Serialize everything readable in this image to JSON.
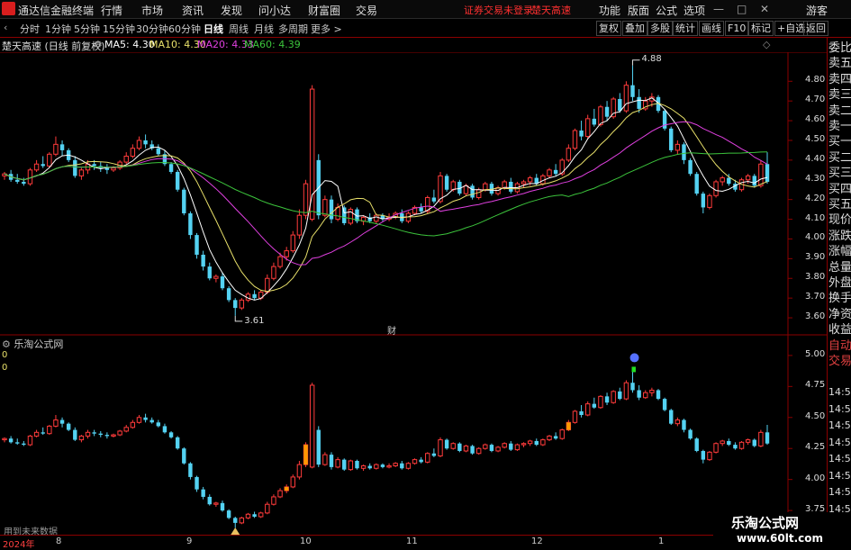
{
  "menu": {
    "app_name": "通达信金融终端",
    "items": [
      "行情",
      "市场",
      "资讯",
      "发现",
      "问小达",
      "财富圈",
      "交易"
    ],
    "warning": "证券交易未登录",
    "stock_name": "楚天高速",
    "right_items": [
      "功能",
      "版面",
      "公式",
      "选项"
    ],
    "guest": "游客",
    "r_label": "R"
  },
  "toolbar": {
    "periods": [
      "分时",
      "1分钟",
      "5分钟",
      "15分钟",
      "30分钟",
      "60分钟",
      "日线",
      "周线",
      "月线",
      "多周期",
      "更多 >"
    ],
    "active_period": "日线",
    "buttons": [
      "复权",
      "叠加",
      "多股",
      "统计",
      "画线",
      "F10",
      "标记",
      "+自选",
      "返回"
    ]
  },
  "infobar": {
    "title": "楚天高速 (日线 前复权)",
    "ma5": "MA5: 4.30",
    "ma10": "MA10: 4.30",
    "ma20": "MA20: 4.33",
    "ma60": "MA60: 4.39"
  },
  "colors": {
    "up": "#ff3b3b",
    "down": "#54d2f2",
    "ma5": "#ffffff",
    "ma10": "#e8e06a",
    "ma20": "#e040e0",
    "ma60": "#3cc43c",
    "frame": "#8b0000"
  },
  "price_axis": [
    "4.80",
    "4.70",
    "4.60",
    "4.50",
    "4.40",
    "4.30",
    "4.20",
    "4.10",
    "4.00",
    "3.90",
    "3.80",
    "3.70",
    "3.60"
  ],
  "price_annotations": {
    "high": "4.88",
    "low": "3.61"
  },
  "cai_mark": "财",
  "indicator": {
    "title": "乐淘公式网",
    "value_a": "0",
    "value_b": "0",
    "axis": [
      "5.00",
      "4.75",
      "4.50",
      "4.25",
      "4.00",
      "3.75"
    ]
  },
  "future_text": "用到未来数据",
  "time_axis": [
    "2024年",
    "8",
    "9",
    "10",
    "11",
    "12",
    "1"
  ],
  "side_panel": [
    "委比",
    "卖五",
    "卖四",
    "卖三",
    "卖二",
    "卖一",
    "买一",
    "买二",
    "买三",
    "买四",
    "买五",
    "现价",
    "涨跌",
    "涨幅",
    "总量",
    "外盘",
    "换手",
    "净资",
    "收益",
    "自动",
    "交易"
  ],
  "side_times": [
    "14:56",
    "14:56",
    "14:56",
    "14:56",
    "14:56",
    "14:56",
    "14:56",
    "14:56"
  ],
  "watermark": {
    "line1": "乐淘公式网",
    "line2": "www.60lt.com"
  },
  "chart_data": {
    "type": "candlestick",
    "price_range": [
      3.55,
      4.92
    ],
    "indicator_range": [
      3.7,
      5.05
    ],
    "candles": [
      [
        4.32,
        4.34,
        4.3,
        4.33
      ],
      [
        4.33,
        4.35,
        4.29,
        4.3
      ],
      [
        4.3,
        4.33,
        4.28,
        4.29
      ],
      [
        4.29,
        4.31,
        4.27,
        4.28
      ],
      [
        4.28,
        4.36,
        4.27,
        4.35
      ],
      [
        4.35,
        4.4,
        4.34,
        4.38
      ],
      [
        4.38,
        4.42,
        4.36,
        4.37
      ],
      [
        4.37,
        4.44,
        4.36,
        4.43
      ],
      [
        4.43,
        4.52,
        4.42,
        4.48
      ],
      [
        4.48,
        4.5,
        4.42,
        4.45
      ],
      [
        4.45,
        4.46,
        4.39,
        4.4
      ],
      [
        4.4,
        4.42,
        4.31,
        4.32
      ],
      [
        4.32,
        4.36,
        4.3,
        4.35
      ],
      [
        4.35,
        4.4,
        4.33,
        4.38
      ],
      [
        4.38,
        4.4,
        4.35,
        4.37
      ],
      [
        4.37,
        4.39,
        4.34,
        4.36
      ],
      [
        4.36,
        4.38,
        4.33,
        4.35
      ],
      [
        4.35,
        4.37,
        4.34,
        4.36
      ],
      [
        4.36,
        4.4,
        4.35,
        4.39
      ],
      [
        4.39,
        4.44,
        4.38,
        4.42
      ],
      [
        4.42,
        4.48,
        4.41,
        4.46
      ],
      [
        4.46,
        4.52,
        4.45,
        4.5
      ],
      [
        4.5,
        4.53,
        4.46,
        4.48
      ],
      [
        4.48,
        4.5,
        4.45,
        4.46
      ],
      [
        4.46,
        4.48,
        4.42,
        4.43
      ],
      [
        4.43,
        4.45,
        4.37,
        4.38
      ],
      [
        4.38,
        4.39,
        4.33,
        4.34
      ],
      [
        4.34,
        4.35,
        4.24,
        4.25
      ],
      [
        4.25,
        4.26,
        4.12,
        4.13
      ],
      [
        4.13,
        4.14,
        4.0,
        4.02
      ],
      [
        4.02,
        4.03,
        3.9,
        3.92
      ],
      [
        3.92,
        3.94,
        3.84,
        3.86
      ],
      [
        3.86,
        3.88,
        3.79,
        3.8
      ],
      [
        3.8,
        3.82,
        3.78,
        3.81
      ],
      [
        3.81,
        3.83,
        3.74,
        3.75
      ],
      [
        3.75,
        3.76,
        3.68,
        3.69
      ],
      [
        3.69,
        3.7,
        3.61,
        3.65
      ],
      [
        3.65,
        3.7,
        3.64,
        3.69
      ],
      [
        3.69,
        3.73,
        3.68,
        3.72
      ],
      [
        3.72,
        3.74,
        3.69,
        3.7
      ],
      [
        3.7,
        3.74,
        3.69,
        3.73
      ],
      [
        3.73,
        3.82,
        3.72,
        3.8
      ],
      [
        3.8,
        3.88,
        3.79,
        3.86
      ],
      [
        3.86,
        3.93,
        3.85,
        3.91
      ],
      [
        3.91,
        3.96,
        3.89,
        3.94
      ],
      [
        3.94,
        4.04,
        3.93,
        4.02
      ],
      [
        4.02,
        4.15,
        4.0,
        4.12
      ],
      [
        4.12,
        4.3,
        4.1,
        4.28
      ],
      [
        4.1,
        4.78,
        4.09,
        4.76
      ],
      [
        4.4,
        4.43,
        4.1,
        4.12
      ],
      [
        4.12,
        4.22,
        4.11,
        4.2
      ],
      [
        4.2,
        4.22,
        4.08,
        4.1
      ],
      [
        4.1,
        4.18,
        4.09,
        4.16
      ],
      [
        4.16,
        4.17,
        4.07,
        4.08
      ],
      [
        4.08,
        4.16,
        4.07,
        4.15
      ],
      [
        4.15,
        4.16,
        4.08,
        4.09
      ],
      [
        4.09,
        4.12,
        4.07,
        4.11
      ],
      [
        4.11,
        4.13,
        4.08,
        4.09
      ],
      [
        4.09,
        4.13,
        4.08,
        4.12
      ],
      [
        4.12,
        4.13,
        4.09,
        4.1
      ],
      [
        4.1,
        4.13,
        4.09,
        4.11
      ],
      [
        4.11,
        4.14,
        4.1,
        4.13
      ],
      [
        4.13,
        4.15,
        4.08,
        4.09
      ],
      [
        4.09,
        4.14,
        4.08,
        4.13
      ],
      [
        4.13,
        4.17,
        4.12,
        4.16
      ],
      [
        4.16,
        4.18,
        4.13,
        4.14
      ],
      [
        4.14,
        4.22,
        4.13,
        4.21
      ],
      [
        4.21,
        4.25,
        4.18,
        4.19
      ],
      [
        4.19,
        4.34,
        4.18,
        4.32
      ],
      [
        4.32,
        4.33,
        4.24,
        4.25
      ],
      [
        4.25,
        4.3,
        4.24,
        4.29
      ],
      [
        4.29,
        4.3,
        4.22,
        4.23
      ],
      [
        4.23,
        4.28,
        4.22,
        4.27
      ],
      [
        4.27,
        4.28,
        4.2,
        4.21
      ],
      [
        4.21,
        4.26,
        4.2,
        4.25
      ],
      [
        4.25,
        4.29,
        4.24,
        4.28
      ],
      [
        4.28,
        4.29,
        4.22,
        4.23
      ],
      [
        4.23,
        4.27,
        4.22,
        4.26
      ],
      [
        4.26,
        4.3,
        4.25,
        4.29
      ],
      [
        4.29,
        4.31,
        4.23,
        4.24
      ],
      [
        4.24,
        4.29,
        4.23,
        4.28
      ],
      [
        4.28,
        4.3,
        4.26,
        4.29
      ],
      [
        4.29,
        4.32,
        4.27,
        4.31
      ],
      [
        4.31,
        4.33,
        4.27,
        4.28
      ],
      [
        4.28,
        4.33,
        4.27,
        4.32
      ],
      [
        4.32,
        4.36,
        4.31,
        4.35
      ],
      [
        4.35,
        4.38,
        4.32,
        4.33
      ],
      [
        4.33,
        4.41,
        4.32,
        4.4
      ],
      [
        4.4,
        4.48,
        4.39,
        4.46
      ],
      [
        4.46,
        4.56,
        4.45,
        4.55
      ],
      [
        4.55,
        4.6,
        4.5,
        4.52
      ],
      [
        4.52,
        4.63,
        4.51,
        4.61
      ],
      [
        4.61,
        4.66,
        4.57,
        4.58
      ],
      [
        4.58,
        4.68,
        4.57,
        4.67
      ],
      [
        4.67,
        4.7,
        4.6,
        4.62
      ],
      [
        4.62,
        4.72,
        4.61,
        4.71
      ],
      [
        4.71,
        4.74,
        4.64,
        4.65
      ],
      [
        4.65,
        4.8,
        4.64,
        4.78
      ],
      [
        4.78,
        4.88,
        4.7,
        4.72
      ],
      [
        4.72,
        4.76,
        4.64,
        4.66
      ],
      [
        4.66,
        4.72,
        4.65,
        4.7
      ],
      [
        4.7,
        4.74,
        4.67,
        4.72
      ],
      [
        4.72,
        4.73,
        4.64,
        4.65
      ],
      [
        4.65,
        4.66,
        4.55,
        4.56
      ],
      [
        4.56,
        4.57,
        4.44,
        4.45
      ],
      [
        4.45,
        4.5,
        4.43,
        4.48
      ],
      [
        4.48,
        4.49,
        4.38,
        4.4
      ],
      [
        4.4,
        4.41,
        4.32,
        4.33
      ],
      [
        4.33,
        4.34,
        4.22,
        4.23
      ],
      [
        4.23,
        4.24,
        4.13,
        4.16
      ],
      [
        4.16,
        4.23,
        4.15,
        4.22
      ],
      [
        4.22,
        4.3,
        4.21,
        4.29
      ],
      [
        4.29,
        4.32,
        4.27,
        4.31
      ],
      [
        4.31,
        4.33,
        4.27,
        4.28
      ],
      [
        4.28,
        4.3,
        4.24,
        4.25
      ],
      [
        4.25,
        4.31,
        4.24,
        4.3
      ],
      [
        4.3,
        4.33,
        4.28,
        4.32
      ],
      [
        4.32,
        4.33,
        4.26,
        4.27
      ],
      [
        4.27,
        4.4,
        4.26,
        4.38
      ],
      [
        4.38,
        4.44,
        4.28,
        4.29
      ]
    ]
  }
}
